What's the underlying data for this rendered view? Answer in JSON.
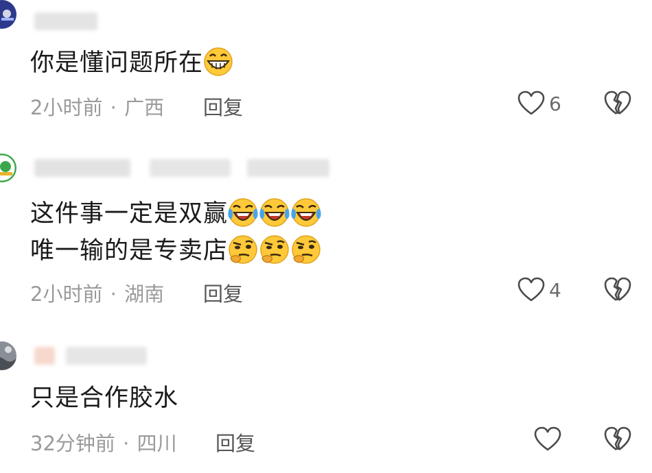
{
  "comments": [
    {
      "lines": [
        "你是懂问题所在"
      ],
      "emojis": [
        [
          "grin"
        ]
      ],
      "time": "2小时前",
      "location": "广西",
      "reply_label": "回复",
      "likes": "6"
    },
    {
      "lines": [
        "这件事一定是双赢",
        "唯一输的是专卖店"
      ],
      "emojis": [
        [
          "laugh-cry",
          "laugh-cry",
          "laugh-cry"
        ],
        [
          "thinking",
          "thinking",
          "thinking"
        ]
      ],
      "time": "2小时前",
      "location": "湖南",
      "reply_label": "回复",
      "likes": "4"
    },
    {
      "lines": [
        "只是合作胶水"
      ],
      "emojis": [
        []
      ],
      "time": "32分钟前",
      "location": "四川",
      "reply_label": "回复",
      "likes": ""
    }
  ],
  "meta_separator": "·",
  "icons": {
    "like": "heart-outline-icon",
    "dislike": "broken-heart-icon"
  },
  "colors": {
    "meta_text": "#9a9a9a",
    "body_text": "#1a1a1a",
    "icon_stroke": "#4a4a4a"
  }
}
